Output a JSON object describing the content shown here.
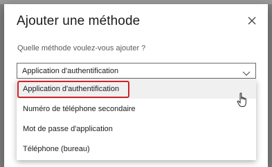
{
  "dialog": {
    "title": "Ajouter une méthode",
    "question": "Quelle méthode voulez-vous ajouter ?",
    "close_icon": "close-icon"
  },
  "select": {
    "value": "Application d'authentification",
    "icon": "chevron-down-icon"
  },
  "options": [
    {
      "label": "Application d'authentification",
      "selected": true
    },
    {
      "label": "Numéro de téléphone secondaire",
      "selected": false
    },
    {
      "label": "Mot de passe d'application",
      "selected": false
    },
    {
      "label": "Téléphone (bureau)",
      "selected": false
    }
  ],
  "annotation": {
    "highlight_color": "#d0212a"
  },
  "cursor": {
    "icon": "hand-pointer-icon"
  }
}
